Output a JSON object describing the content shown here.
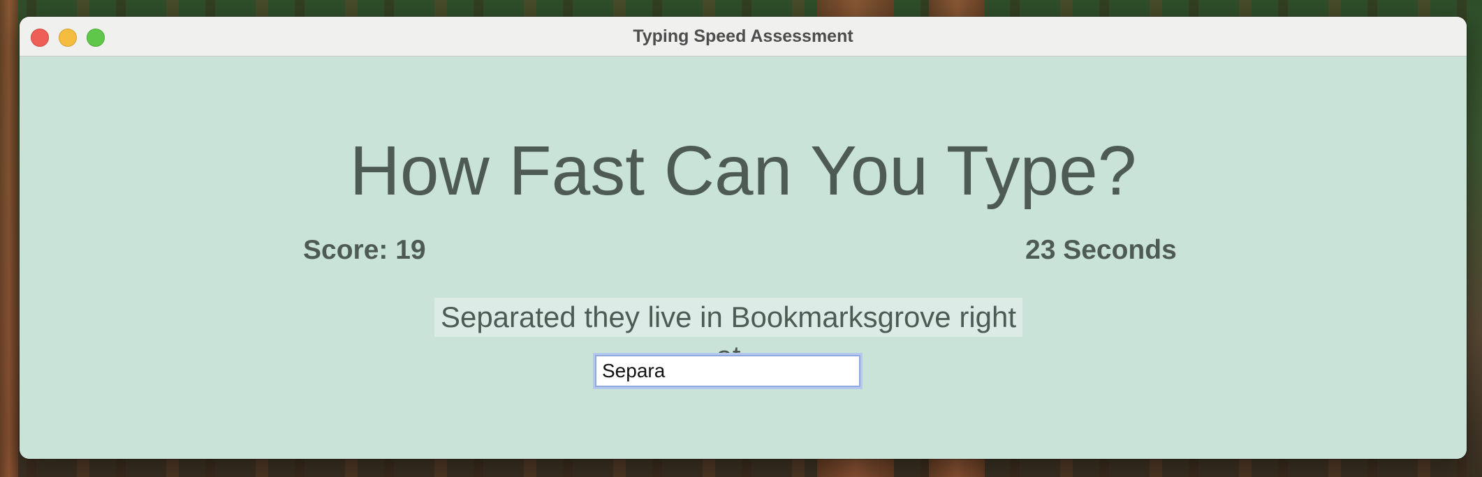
{
  "window": {
    "title": "Typing Speed Assessment"
  },
  "colors": {
    "background": "#c9e3d9",
    "text": "#4e5b55",
    "prompt_highlight": "#dcebe5",
    "input_focus_ring": "#8ea8e0"
  },
  "main": {
    "headline": "How Fast Can You Type?",
    "score_text": "Score: 19",
    "timer_text": "23 Seconds",
    "prompt_text": "Separated they live in Bookmarksgrove right at"
  },
  "input": {
    "value": "Separa"
  }
}
